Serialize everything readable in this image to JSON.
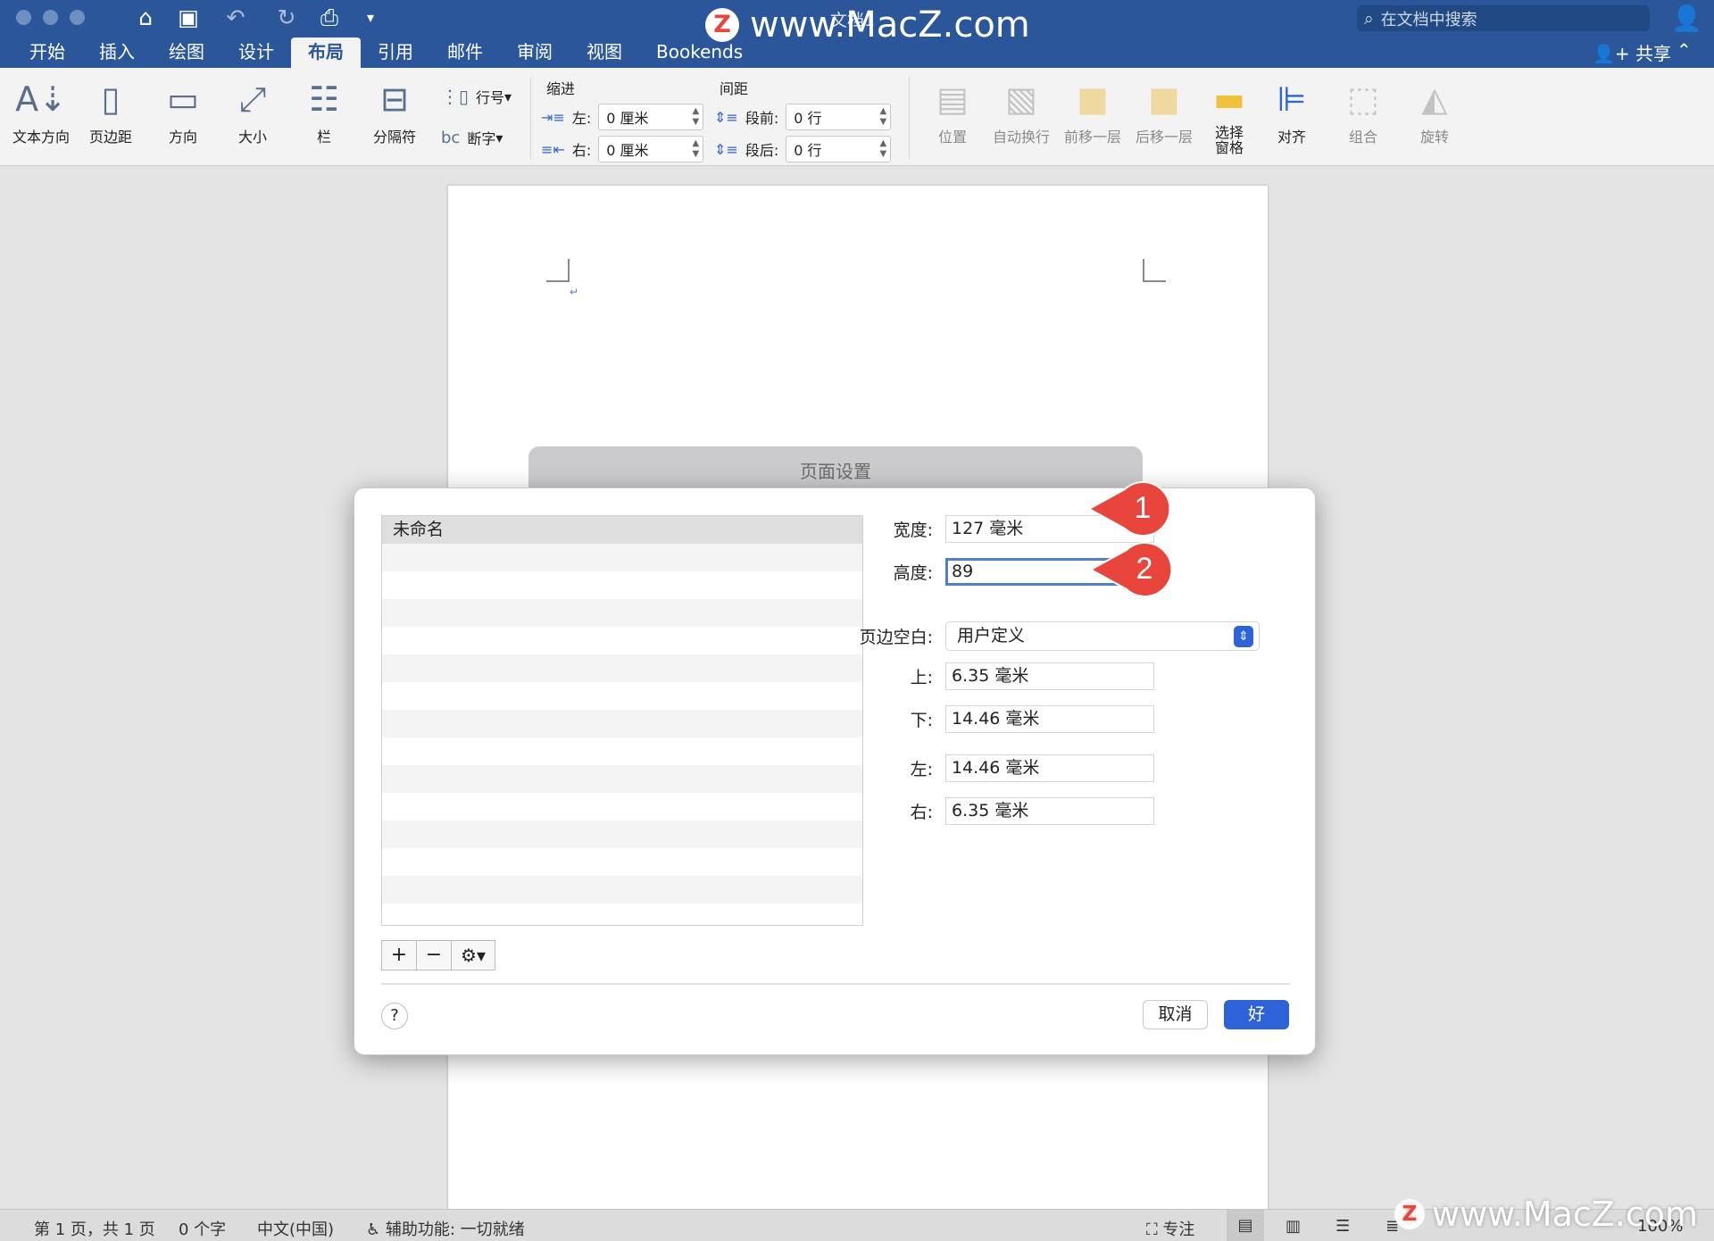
{
  "titlebar": {
    "doc_title": "文档1",
    "watermark": "www.MacZ.com",
    "watermark_logo": "Z",
    "search_placeholder": "在文档中搜索",
    "share_label": "共享"
  },
  "tabs": [
    "开始",
    "插入",
    "绘图",
    "设计",
    "布局",
    "引用",
    "邮件",
    "审阅",
    "视图",
    "Bookends"
  ],
  "active_tab": "布局",
  "ribbon": {
    "text_direction": "文本方向",
    "margins": "页边距",
    "orientation": "方向",
    "size": "大小",
    "columns": "栏",
    "breaks": "分隔符",
    "line_numbers": "行号",
    "hyphenation": "断字",
    "indent_title": "缩进",
    "indent_left_label": "左:",
    "indent_left_value": "0 厘米",
    "indent_right_label": "右:",
    "indent_right_value": "0 厘米",
    "spacing_title": "间距",
    "spacing_before_label": "段前:",
    "spacing_before_value": "0 行",
    "spacing_after_label": "段后:",
    "spacing_after_value": "0 行",
    "position": "位置",
    "wrap_text": "自动换行",
    "bring_forward": "前移一层",
    "send_backward": "后移一层",
    "selection_pane_line1": "选择",
    "selection_pane_line2": "窗格",
    "align": "对齐",
    "group": "组合",
    "rotate": "旋转"
  },
  "sheet": {
    "title": "页面设置"
  },
  "dialog": {
    "list_items": [
      "未命名"
    ],
    "width_label": "宽度:",
    "width_value": "127 毫米",
    "height_label": "高度:",
    "height_value": "89",
    "margins_label": "页边空白:",
    "margins_value": "用户定义",
    "top_label": "上:",
    "top_value": "6.35 毫米",
    "bottom_label": "下:",
    "bottom_value": "14.46 毫米",
    "left_label": "左:",
    "left_value": "14.46 毫米",
    "right_label": "右:",
    "right_value": "6.35 毫米",
    "add_label": "+",
    "remove_label": "−",
    "help_label": "?",
    "cancel_label": "取消",
    "ok_label": "好"
  },
  "callouts": [
    "1",
    "2"
  ],
  "callout_color": "#e8453c",
  "statusbar": {
    "page_info": "第 1 页，共 1 页",
    "word_count": "0 个字",
    "language": "中文(中国)",
    "accessibility": "辅助功能: 一切就绪",
    "focus": "专注",
    "zoom": "100%"
  },
  "colors": {
    "accent": "#2b579a",
    "ribbon_bg": "#f3f3f3",
    "primary_button": "#2e63d8"
  }
}
